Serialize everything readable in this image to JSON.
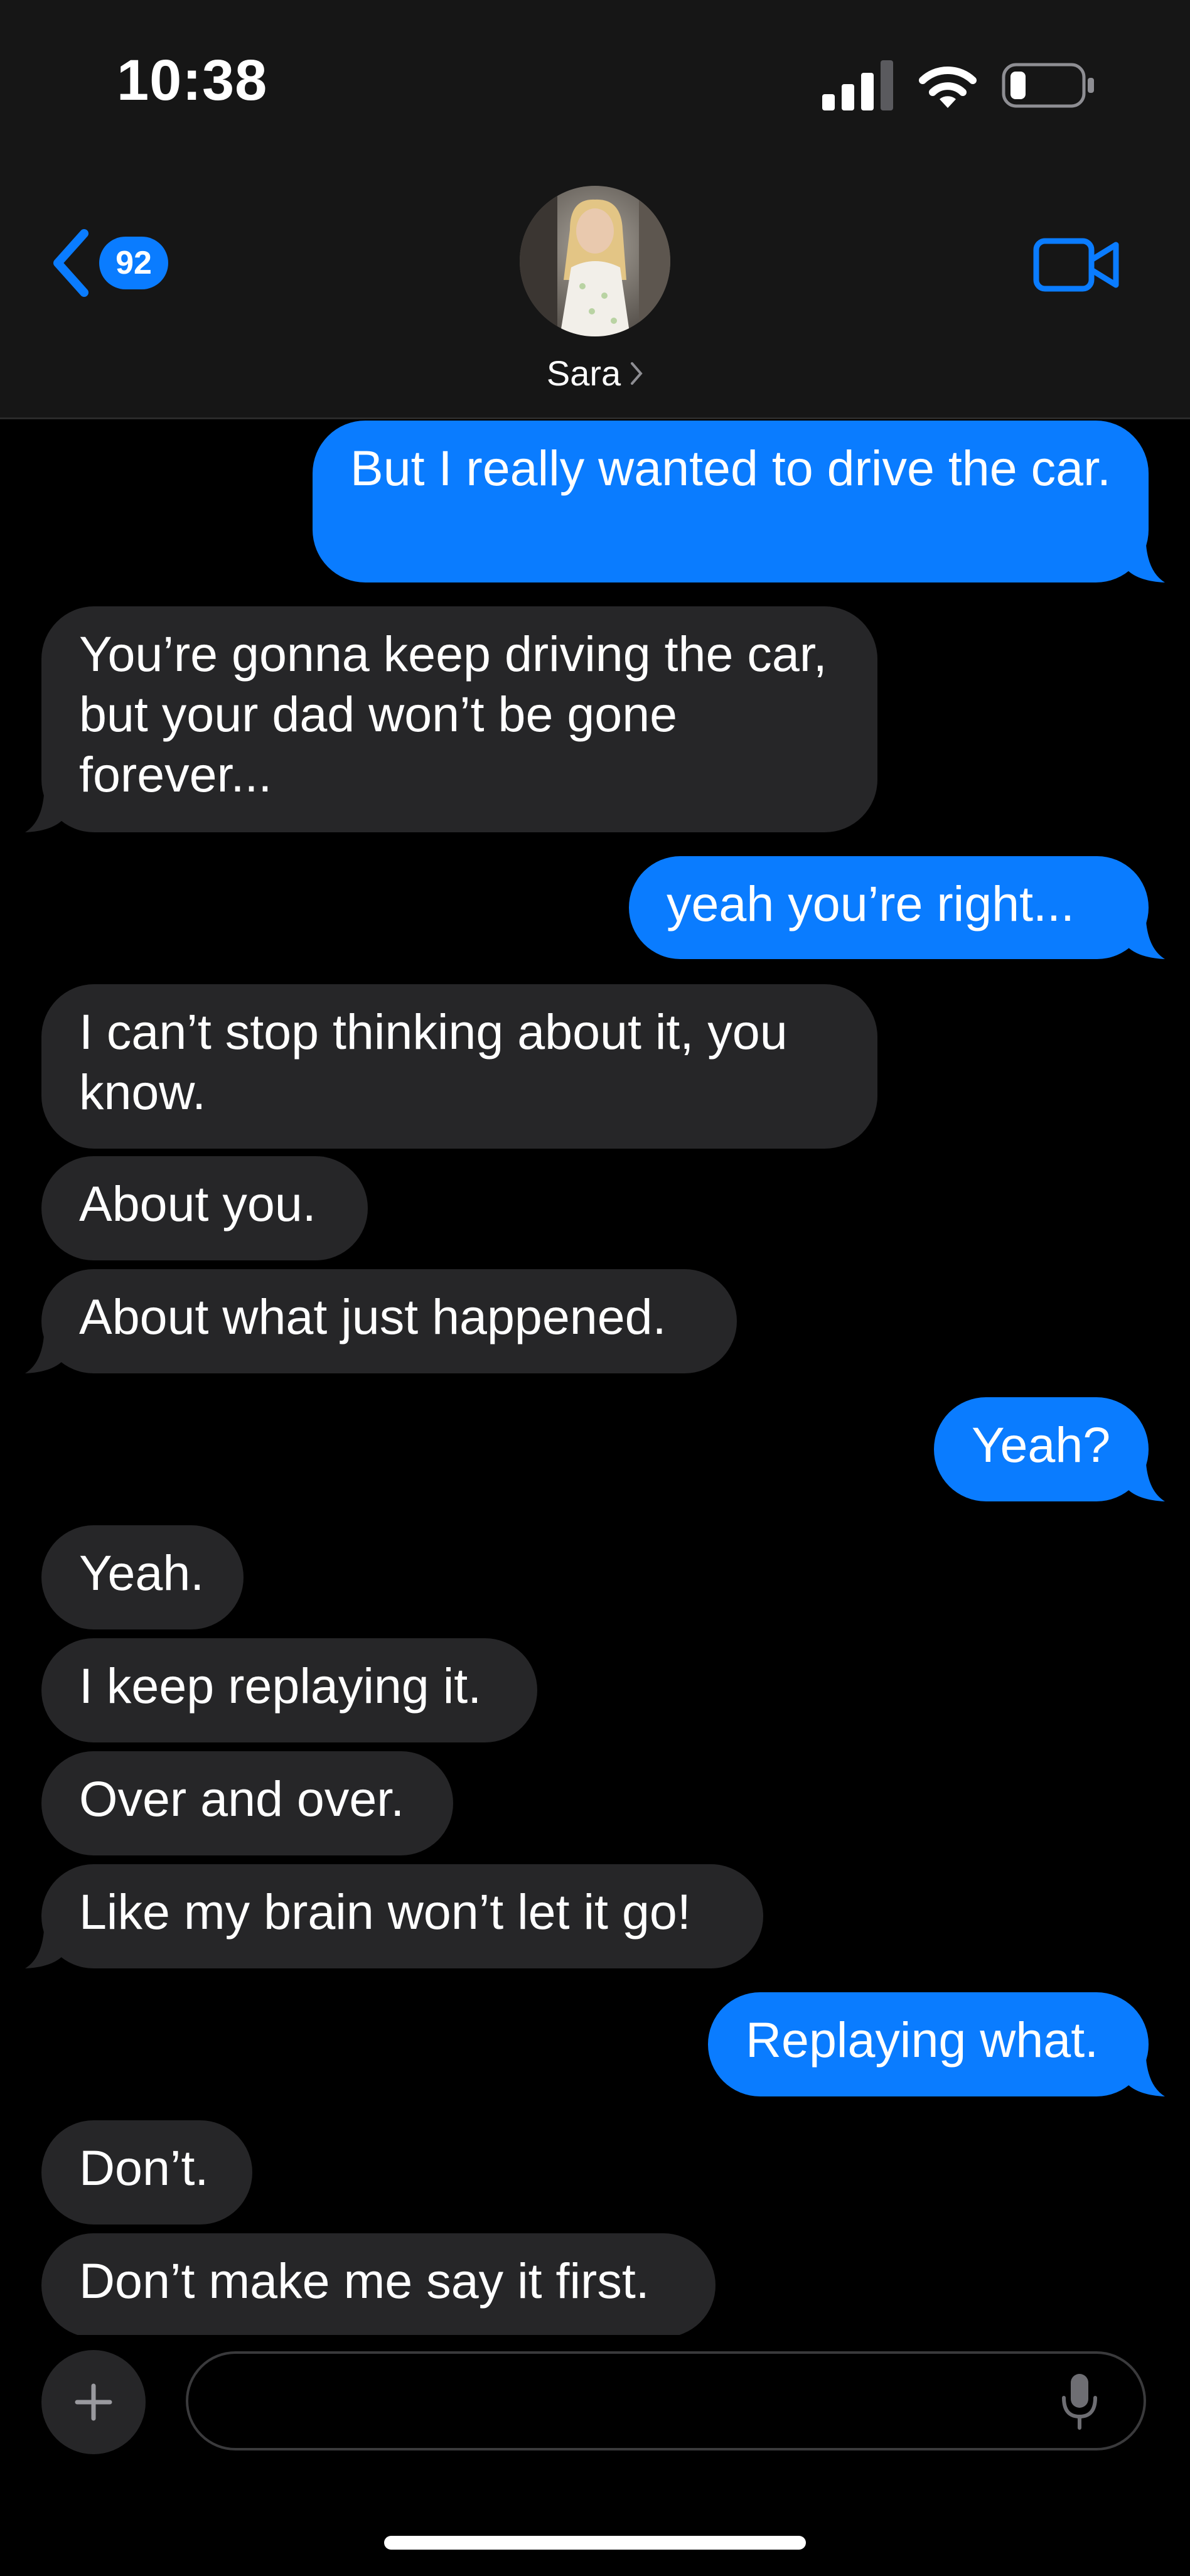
{
  "status_bar": {
    "time": "10:38",
    "icons": [
      "cellular-signal-icon",
      "wifi-icon",
      "battery-icon"
    ]
  },
  "nav": {
    "back_icon": "chevron-left-icon",
    "unread_count": "92",
    "contact_name": "Sara",
    "contact_chevron_icon": "chevron-right-icon",
    "video_icon": "video-camera-icon"
  },
  "colors": {
    "accent": "#0a7cff",
    "outgoing_bubble": "#0a7cff",
    "incoming_bubble": "#262628",
    "background": "#000000",
    "header_background": "#161616"
  },
  "messages": [
    {
      "direction": "out",
      "text": "But I really wanted to drive the car."
    },
    {
      "direction": "in",
      "text": "You’re gonna keep driving the car, but your dad won’t be gone forever..."
    },
    {
      "direction": "out",
      "text": "yeah you’re right..."
    },
    {
      "direction": "in",
      "text": "I can’t stop thinking about it, you know."
    },
    {
      "direction": "in",
      "text": "About you."
    },
    {
      "direction": "in",
      "text": "About what just happened."
    },
    {
      "direction": "out",
      "text": "Yeah?"
    },
    {
      "direction": "in",
      "text": "Yeah."
    },
    {
      "direction": "in",
      "text": "I keep replaying it."
    },
    {
      "direction": "in",
      "text": "Over and over."
    },
    {
      "direction": "in",
      "text": "Like my brain won’t let it go!"
    },
    {
      "direction": "out",
      "text": "Replaying what."
    },
    {
      "direction": "in",
      "text": "Don’t."
    },
    {
      "direction": "in",
      "text": "Don’t make me say it first."
    }
  ],
  "composer": {
    "add_icon": "plus-icon",
    "input_value": "",
    "input_placeholder": "",
    "mic_icon": "microphone-icon"
  }
}
